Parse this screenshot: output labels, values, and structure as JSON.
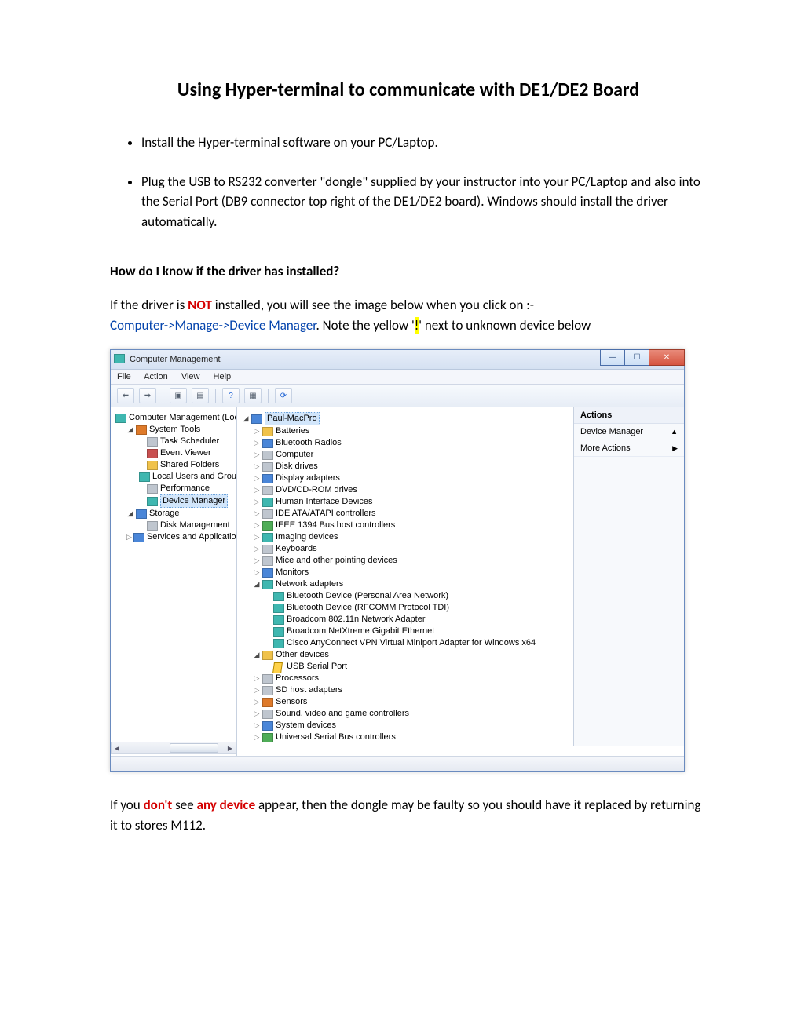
{
  "doc": {
    "title": "Using Hyper-terminal to communicate with DE1/DE2 Board",
    "bullets": [
      "Install the Hyper-terminal software on your PC/Laptop.",
      "Plug the USB to RS232 converter \"dongle\" supplied by your instructor into your PC/Laptop and also into the Serial Port (DB9 connector top right of the DE1/DE2 board). Windows should install the driver automatically."
    ],
    "subheading": "How do I know if the driver has installed?",
    "p1_a": "If the driver is ",
    "p1_not": "NOT",
    "p1_b": " installed, you will see the image below when you click on :-",
    "p2_path": "Computer->Manage->Device Manager",
    "p2_b": ". Note the yellow '",
    "p2_bang": "!",
    "p2_c": "' next to unknown device below",
    "p3_a": "If you ",
    "p3_dont": "don't",
    "p3_b": " see ",
    "p3_any": "any device",
    "p3_c": " appear, then the dongle may be faulty so you should have it replaced by returning it to stores M112."
  },
  "win": {
    "title": "Computer Management",
    "menu": [
      "File",
      "Action",
      "View",
      "Help"
    ],
    "actions": {
      "header": "Actions",
      "item1": "Device Manager",
      "item2": "More Actions"
    },
    "left_root": "Computer Management (Local",
    "left": [
      {
        "label": "System Tools",
        "icon": "ic-orange",
        "open": true,
        "children": [
          {
            "label": "Task Scheduler",
            "icon": "ic-gray"
          },
          {
            "label": "Event Viewer",
            "icon": "ic-red"
          },
          {
            "label": "Shared Folders",
            "icon": "ic-yellow"
          },
          {
            "label": "Local Users and Groups",
            "icon": "ic-teal"
          },
          {
            "label": "Performance",
            "icon": "ic-gray"
          },
          {
            "label": "Device Manager",
            "icon": "ic-teal",
            "selected": true
          }
        ]
      },
      {
        "label": "Storage",
        "icon": "ic-blue",
        "open": true,
        "children": [
          {
            "label": "Disk Management",
            "icon": "ic-gray"
          }
        ]
      },
      {
        "label": "Services and Applications",
        "icon": "ic-blue"
      }
    ],
    "mid_root": "Paul-MacPro",
    "mid": [
      {
        "label": "Batteries",
        "icon": "ic-yellow"
      },
      {
        "label": "Bluetooth Radios",
        "icon": "ic-blue"
      },
      {
        "label": "Computer",
        "icon": "ic-gray"
      },
      {
        "label": "Disk drives",
        "icon": "ic-gray"
      },
      {
        "label": "Display adapters",
        "icon": "ic-blue"
      },
      {
        "label": "DVD/CD-ROM drives",
        "icon": "ic-gray"
      },
      {
        "label": "Human Interface Devices",
        "icon": "ic-teal"
      },
      {
        "label": "IDE ATA/ATAPI controllers",
        "icon": "ic-gray"
      },
      {
        "label": "IEEE 1394 Bus host controllers",
        "icon": "ic-green"
      },
      {
        "label": "Imaging devices",
        "icon": "ic-teal"
      },
      {
        "label": "Keyboards",
        "icon": "ic-gray"
      },
      {
        "label": "Mice and other pointing devices",
        "icon": "ic-gray"
      },
      {
        "label": "Monitors",
        "icon": "ic-blue"
      },
      {
        "label": "Network adapters",
        "icon": "ic-teal",
        "open": true,
        "children": [
          {
            "label": "Bluetooth Device (Personal Area Network)",
            "icon": "ic-teal"
          },
          {
            "label": "Bluetooth Device (RFCOMM Protocol TDI)",
            "icon": "ic-teal"
          },
          {
            "label": "Broadcom 802.11n Network Adapter",
            "icon": "ic-teal"
          },
          {
            "label": "Broadcom NetXtreme Gigabit Ethernet",
            "icon": "ic-teal"
          },
          {
            "label": "Cisco AnyConnect VPN Virtual Miniport Adapter for Windows x64",
            "icon": "ic-teal"
          }
        ]
      },
      {
        "label": "Other devices",
        "icon": "ic-yellow",
        "open": true,
        "children": [
          {
            "label": "USB Serial Port",
            "icon": "warn"
          }
        ]
      },
      {
        "label": "Processors",
        "icon": "ic-gray"
      },
      {
        "label": "SD host adapters",
        "icon": "ic-gray"
      },
      {
        "label": "Sensors",
        "icon": "ic-orange"
      },
      {
        "label": "Sound, video and game controllers",
        "icon": "ic-gray"
      },
      {
        "label": "System devices",
        "icon": "ic-blue"
      },
      {
        "label": "Universal Serial Bus controllers",
        "icon": "ic-green"
      }
    ]
  }
}
